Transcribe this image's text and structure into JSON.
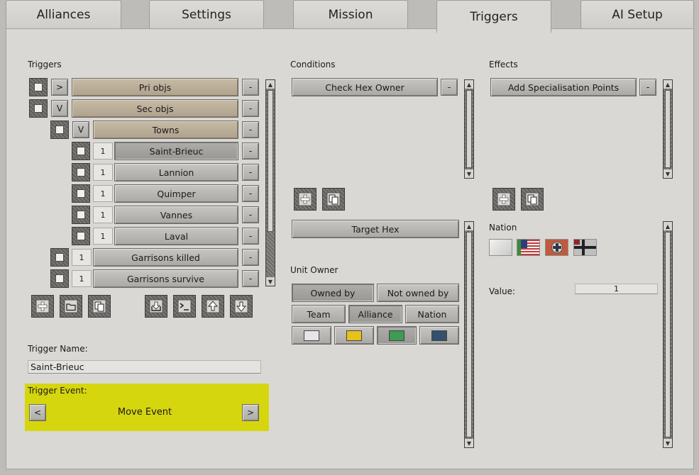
{
  "tabs": [
    {
      "label": "Alliances"
    },
    {
      "label": "Settings"
    },
    {
      "label": "Mission"
    },
    {
      "label": "Triggers",
      "active": true
    },
    {
      "label": "AI Setup"
    }
  ],
  "triggers": {
    "heading": "Triggers",
    "remove_symbol": "-",
    "rows": [
      {
        "toggle": ">",
        "label": "Pri objs"
      },
      {
        "toggle": "V",
        "label": "Sec objs"
      },
      {
        "toggle": "V",
        "label": "Towns"
      },
      {
        "count": "1",
        "label": "Saint-Brieuc"
      },
      {
        "count": "1",
        "label": "Lannion"
      },
      {
        "count": "1",
        "label": "Quimper"
      },
      {
        "count": "1",
        "label": "Vannes"
      },
      {
        "count": "1",
        "label": "Laval"
      },
      {
        "count": "1",
        "label": "Garrisons killed"
      },
      {
        "count": "1",
        "label": "Garrisons survive"
      }
    ],
    "name_label": "Trigger Name:",
    "name_value": "Saint-Brieuc",
    "event_label": "Trigger Event:",
    "event_value": "Move Event",
    "prev_symbol": "<",
    "next_symbol": ">",
    "highlight_color": "#d6d60e"
  },
  "conditions": {
    "heading": "Conditions",
    "item": "Check Hex Owner",
    "remove_symbol": "-",
    "target_hex": "Target Hex",
    "unit_owner_label": "Unit Owner",
    "owned_by": "Owned by",
    "not_owned_by": "Not owned by",
    "team": "Team",
    "alliance": "Alliance",
    "nation": "Nation",
    "swatch_colors": [
      "#e6e6e6",
      "#e6c21a",
      "#3d9b54",
      "#34506c"
    ]
  },
  "effects": {
    "heading": "Effects",
    "item": "Add Specialisation Points",
    "remove_symbol": "-",
    "nation_label": "Nation",
    "value_label": "Value:",
    "value": "1"
  }
}
